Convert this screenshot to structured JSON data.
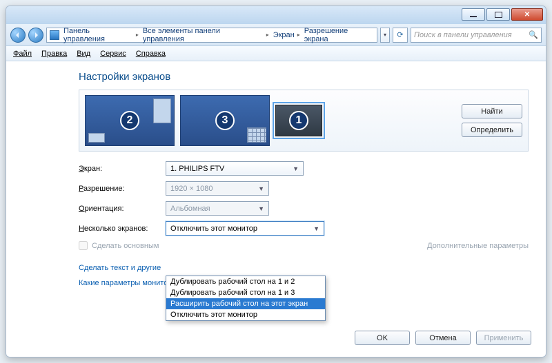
{
  "breadcrumb": {
    "root": "Панель управления",
    "item1": "Все элементы панели управления",
    "item2": "Экран",
    "item3": "Разрешение экрана"
  },
  "search": {
    "placeholder": "Поиск в панели управления"
  },
  "menu": {
    "file": "Файл",
    "edit": "Правка",
    "view": "Вид",
    "service": "Сервис",
    "help": "Справка"
  },
  "heading": "Настройки экранов",
  "monitors": {
    "m1": "1",
    "m2": "2",
    "m3": "3"
  },
  "side": {
    "find": "Найти",
    "detect": "Определить"
  },
  "labels": {
    "screen": "Экран:",
    "resolution": "Разрешение:",
    "orientation": "Ориентация:",
    "multi": "Несколько экранов:"
  },
  "values": {
    "screen": "1. PHILIPS FTV",
    "resolution": "1920 × 1080",
    "orientation": "Альбомная",
    "multi": "Отключить этот монитор"
  },
  "dropdown": {
    "opt0": "Дублировать рабочий стол на 1 и 2",
    "opt1": "Дублировать рабочий стол на 1 и 3",
    "opt2": "Расширить рабочий стол на этот экран",
    "opt3": "Отключить этот монитор"
  },
  "checkbox": "Сделать основным",
  "extra_link": "Дополнительные параметры",
  "link1": "Сделать текст и другие",
  "link2": "Какие параметры монитора следует выбрать?",
  "buttons": {
    "ok": "OK",
    "cancel": "Отмена",
    "apply": "Применить"
  }
}
